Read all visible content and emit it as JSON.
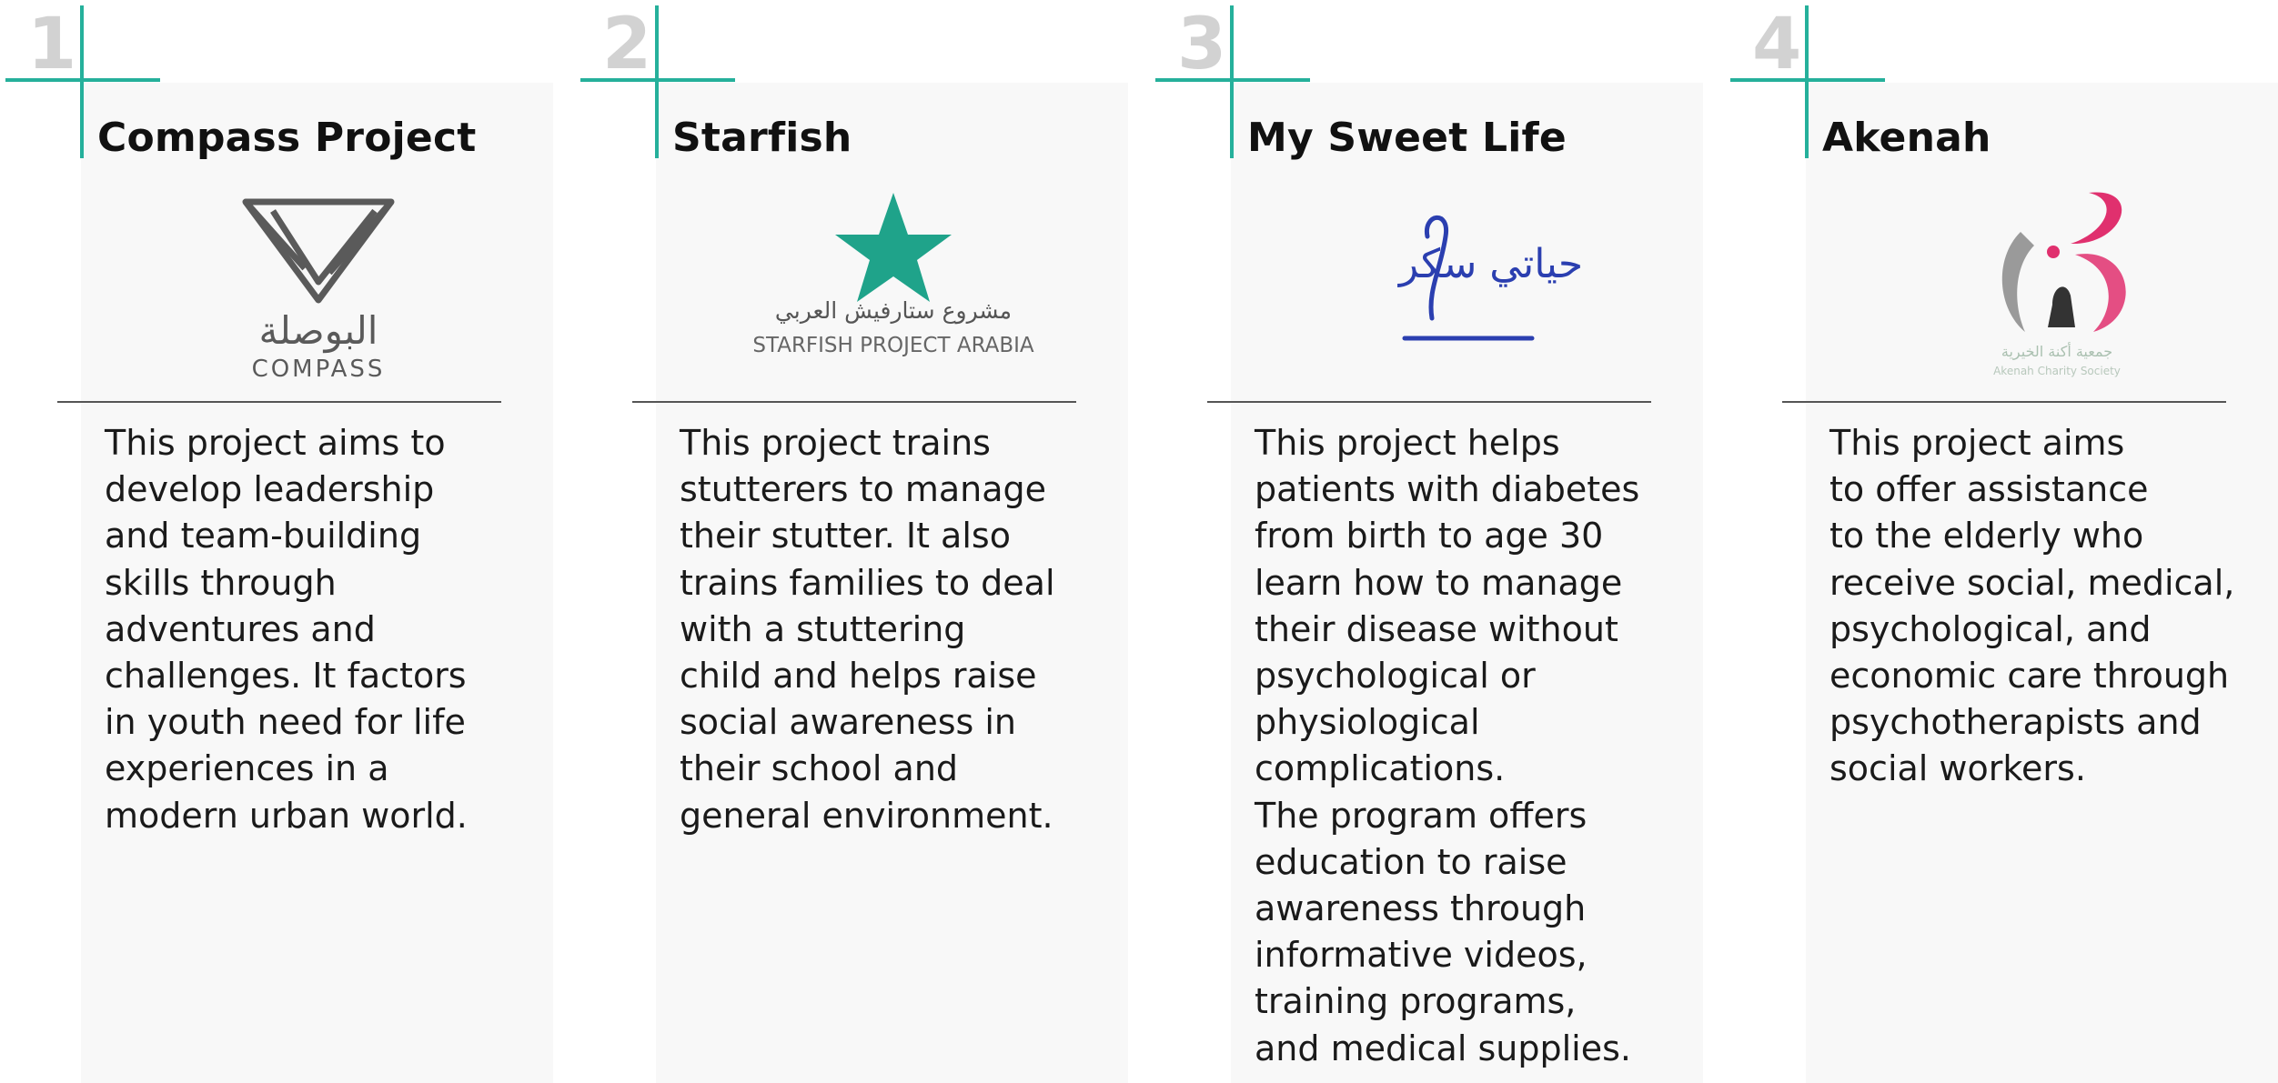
{
  "cards": [
    {
      "number": "1",
      "title": "Compass Project",
      "logo": {
        "icon": "compass-logo-icon",
        "arabic": "البوصلة",
        "caption": "COMPASS",
        "color": "#5a5a5a"
      },
      "description": "This project aims to\ndevelop leadership\nand team-building\nskills through\nadventures and\nchallenges. It factors\nin youth need for life\nexperiences in a\nmodern urban world."
    },
    {
      "number": "2",
      "title": "Starfish",
      "logo": {
        "icon": "starfish-logo-icon",
        "arabic": "مشروع ستارفيش العربي",
        "caption": "STARFISH PROJECT ARABIA",
        "color": "#1fa38a"
      },
      "description": "This project trains\nstutterers to manage\ntheir stutter. It also\ntrains families to deal\nwith a stuttering\nchild and helps raise\nsocial awareness in\ntheir school and\ngeneral environment."
    },
    {
      "number": "3",
      "title": "My Sweet Life",
      "logo": {
        "icon": "my-sweet-life-logo-icon",
        "arabic": "حياتي سكر",
        "color": "#2b3fb0"
      },
      "description": "This project helps\npatients with diabetes\nfrom birth to age 30\nlearn how to manage\ntheir disease without\npsychological or\nphysiological\ncomplications.\nThe program offers\neducation to raise\nawareness through\ninformative videos,\ntraining programs,\nand medical supplies."
    },
    {
      "number": "4",
      "title": "Akenah",
      "logo": {
        "icon": "akenah-logo-icon",
        "arabic": "جمعية أكنة الخيرية",
        "caption": "Akenah Charity Society",
        "color": "#e0306e"
      },
      "description": "This project aims\nto offer assistance\nto the elderly who\nreceive social, medical,\npsychological, and\neconomic care through\npsychotherapists and\nsocial workers."
    }
  ],
  "colors": {
    "accent": "#25b09b",
    "number_gray": "#d2d2d2",
    "card_bg": "#f8f8f8"
  }
}
